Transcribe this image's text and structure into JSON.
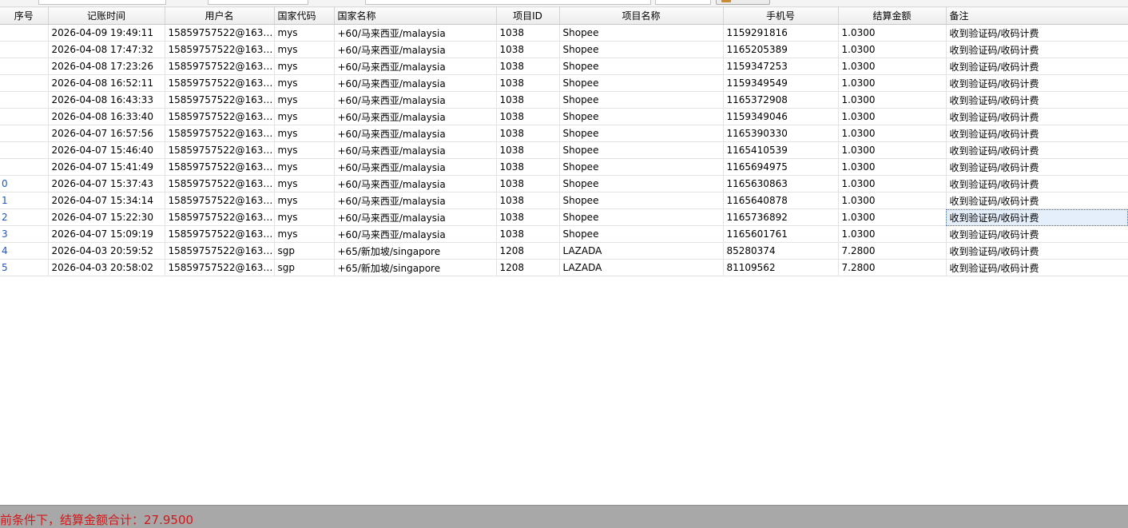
{
  "filters": {
    "fields": [
      {
        "name": "filter-field-1",
        "value": ""
      },
      {
        "name": "filter-field-2",
        "value": ""
      },
      {
        "name": "filter-field-3",
        "value": ""
      },
      {
        "name": "filter-field-4",
        "value": ""
      }
    ]
  },
  "table": {
    "headers": [
      "序号",
      "记账时间",
      "用户名",
      "国家代码",
      "国家名称",
      "项目ID",
      "项目名称",
      "手机号",
      "结算金额",
      "备注"
    ],
    "rows": [
      [
        "",
        "2026-04-09 19:49:11",
        "15859757522@163....",
        "mys",
        "+60/马来西亚/malaysia",
        "1038",
        "Shopee",
        "1159291816",
        "1.0300",
        "收到验证码/收码计费"
      ],
      [
        "",
        "2026-04-08 17:47:32",
        "15859757522@163....",
        "mys",
        "+60/马来西亚/malaysia",
        "1038",
        "Shopee",
        "1165205389",
        "1.0300",
        "收到验证码/收码计费"
      ],
      [
        "",
        "2026-04-08 17:23:26",
        "15859757522@163....",
        "mys",
        "+60/马来西亚/malaysia",
        "1038",
        "Shopee",
        "1159347253",
        "1.0300",
        "收到验证码/收码计费"
      ],
      [
        "",
        "2026-04-08 16:52:11",
        "15859757522@163....",
        "mys",
        "+60/马来西亚/malaysia",
        "1038",
        "Shopee",
        "1159349549",
        "1.0300",
        "收到验证码/收码计费"
      ],
      [
        "",
        "2026-04-08 16:43:33",
        "15859757522@163....",
        "mys",
        "+60/马来西亚/malaysia",
        "1038",
        "Shopee",
        "1165372908",
        "1.0300",
        "收到验证码/收码计费"
      ],
      [
        "",
        "2026-04-08 16:33:40",
        "15859757522@163....",
        "mys",
        "+60/马来西亚/malaysia",
        "1038",
        "Shopee",
        "1159349046",
        "1.0300",
        "收到验证码/收码计费"
      ],
      [
        "",
        "2026-04-07 16:57:56",
        "15859757522@163....",
        "mys",
        "+60/马来西亚/malaysia",
        "1038",
        "Shopee",
        "1165390330",
        "1.0300",
        "收到验证码/收码计费"
      ],
      [
        "",
        "2026-04-07 15:46:40",
        "15859757522@163....",
        "mys",
        "+60/马来西亚/malaysia",
        "1038",
        "Shopee",
        "1165410539",
        "1.0300",
        "收到验证码/收码计费"
      ],
      [
        "",
        "2026-04-07 15:41:49",
        "15859757522@163....",
        "mys",
        "+60/马来西亚/malaysia",
        "1038",
        "Shopee",
        "1165694975",
        "1.0300",
        "收到验证码/收码计费"
      ],
      [
        "0",
        "2026-04-07 15:37:43",
        "15859757522@163....",
        "mys",
        "+60/马来西亚/malaysia",
        "1038",
        "Shopee",
        "1165630863",
        "1.0300",
        "收到验证码/收码计费"
      ],
      [
        "1",
        "2026-04-07 15:34:14",
        "15859757522@163....",
        "mys",
        "+60/马来西亚/malaysia",
        "1038",
        "Shopee",
        "1165640878",
        "1.0300",
        "收到验证码/收码计费"
      ],
      [
        "2",
        "2026-04-07 15:22:30",
        "15859757522@163....",
        "mys",
        "+60/马来西亚/malaysia",
        "1038",
        "Shopee",
        "1165736892",
        "1.0300",
        "收到验证码/收码计费"
      ],
      [
        "3",
        "2026-04-07 15:09:19",
        "15859757522@163....",
        "mys",
        "+60/马来西亚/malaysia",
        "1038",
        "Shopee",
        "1165601761",
        "1.0300",
        "收到验证码/收码计费"
      ],
      [
        "4",
        "2026-04-03 20:59:52",
        "15859757522@163....",
        "sgp",
        "+65/新加坡/singapore",
        "1208",
        "LAZADA",
        "85280374",
        "7.2800",
        "收到验证码/收码计费"
      ],
      [
        "5",
        "2026-04-03 20:58:02",
        "15859757522@163....",
        "sgp",
        "+65/新加坡/singapore",
        "1208",
        "LAZADA",
        "81109562",
        "7.2800",
        "收到验证码/收码计费"
      ]
    ],
    "selected_cell": {
      "row": 11,
      "col": 9
    }
  },
  "status": {
    "text": "前条件下，结算金额合计：27.9500"
  },
  "colors": {
    "status_text": "#d1181b",
    "status_bg": "#a8a8a8",
    "seq_text": "#1a56c8",
    "selection_bg": "#e5eefb"
  }
}
